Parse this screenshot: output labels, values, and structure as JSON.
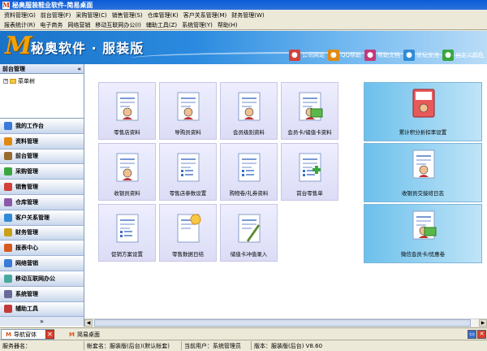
{
  "window": {
    "title": "秘奥服装鞋业软件-简易桌面"
  },
  "menu_row1": [
    "资料管理(G)",
    "前台管理(F)",
    "采购管理(C)",
    "销售管理(S)",
    "仓库管理(K)",
    "客户关系管理(M)",
    "财务管理(W)"
  ],
  "menu_row2": [
    "报表统计(R)",
    "电子商务",
    "网络营销",
    "移动互联网办公(I)",
    "辅助工具(Z)",
    "系统管理(Y)",
    "帮助(H)"
  ],
  "banner": {
    "title": "秘奥软件 · 服装版",
    "links": [
      {
        "label": "公司网站",
        "icon": "home-icon",
        "color": "#d0423a"
      },
      {
        "label": "QQ帮助",
        "icon": "qq-icon",
        "color": "#e08a12"
      },
      {
        "label": "帮助文档",
        "icon": "help-icon",
        "color": "#c23a7a"
      },
      {
        "label": "论坛交流",
        "icon": "forum-icon",
        "color": "#2f8bd6"
      },
      {
        "label": "自定义颜色",
        "icon": "palette-icon",
        "color": "#3aa640"
      }
    ]
  },
  "left_panel": {
    "title": "前台管理",
    "collapse_glyph": "«",
    "tree_root": "菜单树",
    "nav": [
      {
        "label": "我的工作台",
        "color": "#3a7ad8"
      },
      {
        "label": "资料管理",
        "color": "#e08a12"
      },
      {
        "label": "前台管理",
        "color": "#9a6b30"
      },
      {
        "label": "采购管理",
        "color": "#3aa640"
      },
      {
        "label": "销售管理",
        "color": "#d0423a"
      },
      {
        "label": "仓库管理",
        "color": "#8a5aa8"
      },
      {
        "label": "客户关系管理",
        "color": "#2f8bd6"
      },
      {
        "label": "财务管理",
        "color": "#c9a017"
      },
      {
        "label": "报表中心",
        "color": "#d65a20"
      },
      {
        "label": "网络营销",
        "color": "#3a7ad8"
      },
      {
        "label": "移动互联网办公",
        "color": "#4aa8a0"
      },
      {
        "label": "系统管理",
        "color": "#6a6a9a"
      },
      {
        "label": "辅助工具",
        "color": "#c23a3a"
      }
    ],
    "expand_glyph": "»"
  },
  "tiles": [
    {
      "label": "零售店资料",
      "icon": "store-document-icon"
    },
    {
      "label": "导购员资料",
      "icon": "staff-card-icon"
    },
    {
      "label": "会员级别资料",
      "icon": "member-level-icon"
    },
    {
      "label": "会员卡/储值卡资料",
      "icon": "member-card-icon"
    },
    {
      "label": "收银员资料",
      "icon": "cashier-icon"
    },
    {
      "label": "零售店参数设置",
      "icon": "settings-list-icon"
    },
    {
      "label": "购物卷/礼券资料",
      "icon": "coupon-icon"
    },
    {
      "label": "前台零售单",
      "icon": "retail-receipt-icon"
    },
    {
      "label": "促销方案设置",
      "icon": "promotion-icon"
    },
    {
      "label": "零售数据日结",
      "icon": "daily-settle-icon"
    },
    {
      "label": "储值卡冲值录入",
      "icon": "recharge-icon"
    }
  ],
  "wide_tiles": [
    {
      "label": "累计积分折扣率设置",
      "icon": "points-book-icon"
    },
    {
      "label": "收银员交接班日志",
      "icon": "shift-log-icon"
    },
    {
      "label": "微信会员卡/优惠卷",
      "icon": "wechat-card-icon"
    }
  ],
  "tabs": {
    "nav_tab": "导航窗体",
    "desktop_tab": "简易桌面",
    "close_glyph": "✕"
  },
  "status": {
    "server": "服务器名：",
    "account": "帐套名：服装版(后台)(默认帐套)",
    "user": "当前用户：系统管理员",
    "version": "版本：服装版(后台) V8.60"
  }
}
